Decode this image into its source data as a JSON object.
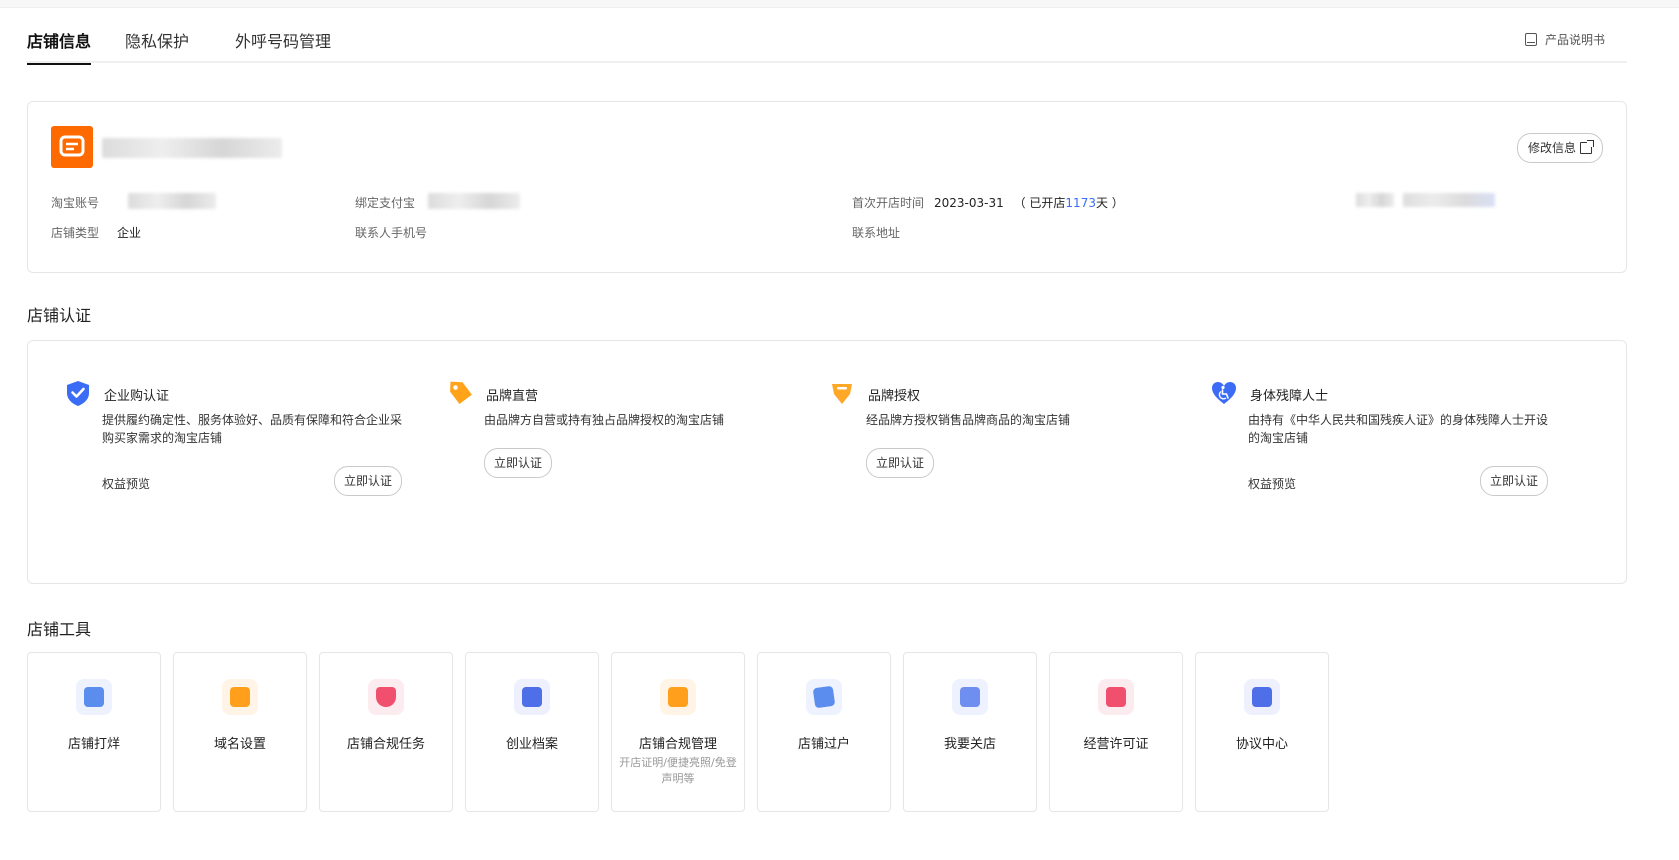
{
  "tabs": [
    {
      "label": "店铺信息",
      "active": true
    },
    {
      "label": "隐私保护",
      "active": false
    },
    {
      "label": "外呼号码管理",
      "active": false
    }
  ],
  "manual_link": "产品说明书",
  "store": {
    "edit_label": "修改信息",
    "fields": {
      "taobao_account_label": "淘宝账号",
      "alipay_label": "绑定支付宝",
      "open_time_label": "首次开店时间",
      "open_date": "2023-03-31",
      "open_prefix": "（ 已开店",
      "open_days": "1173",
      "open_suffix": "天 ）",
      "store_type_label": "店铺类型",
      "store_type_value": "企业",
      "contact_phone_label": "联系人手机号",
      "contact_address_label": "联系地址"
    }
  },
  "certification": {
    "title": "店铺认证",
    "items": [
      {
        "title": "企业购认证",
        "desc": "提供履约确定性、服务体验好、品质有保障和符合企业采购买家需求的淘宝店铺",
        "benefit": "权益预览",
        "button": "立即认证",
        "icon": "shield-check-icon",
        "color": "#3b6cf6"
      },
      {
        "title": "品牌直营",
        "desc": "由品牌方自营或持有独占品牌授权的淘宝店铺",
        "button": "立即认证",
        "icon": "tag-icon",
        "color": "#ff9f1c"
      },
      {
        "title": "品牌授权",
        "desc": "经品牌方授权销售品牌商品的淘宝店铺",
        "button": "立即认证",
        "icon": "diamond-icon",
        "color": "#ffa726"
      },
      {
        "title": "身体残障人士",
        "desc": "由持有《中华人民共和国残疾人证》的身体残障人士开设的淘宝店铺",
        "benefit": "权益预览",
        "button": "立即认证",
        "icon": "accessibility-heart-icon",
        "color": "#3b6cf6"
      }
    ]
  },
  "tools": {
    "title": "店铺工具",
    "items": [
      {
        "label": "店铺打烊",
        "sub": "",
        "icon": "store-closed-icon",
        "color": "#5b8def"
      },
      {
        "label": "域名设置",
        "sub": "",
        "icon": "domain-icon",
        "color": "#ff9f1c"
      },
      {
        "label": "店铺合规任务",
        "sub": "",
        "icon": "shield-search-icon",
        "color": "#f0506e"
      },
      {
        "label": "创业档案",
        "sub": "",
        "icon": "archive-check-icon",
        "color": "#4f6fe8"
      },
      {
        "label": "店铺合规管理",
        "sub": "开店证明/便捷亮照/免登声明等",
        "icon": "compliance-doc-icon",
        "color": "#ff9f1c"
      },
      {
        "label": "店铺过户",
        "sub": "",
        "icon": "transfer-card-icon",
        "color": "#5b8def"
      },
      {
        "label": "我要关店",
        "sub": "",
        "icon": "close-store-icon",
        "color": "#6f8ff0"
      },
      {
        "label": "经营许可证",
        "sub": "",
        "icon": "license-folder-icon",
        "color": "#f0506e"
      },
      {
        "label": "协议中心",
        "sub": "",
        "icon": "agreement-icon",
        "color": "#4f6fe8"
      }
    ]
  }
}
